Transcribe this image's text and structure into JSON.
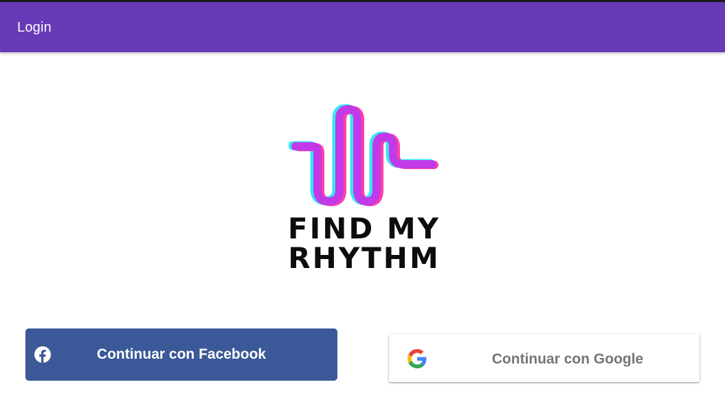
{
  "app_bar": {
    "title": "Login",
    "color": "#673ab7"
  },
  "logo": {
    "line1": "FIND MY",
    "line2": "RHYTHM",
    "wave_color": "#c23ae8",
    "shadow_cyan": "#36e6f2",
    "shadow_pink": "#ff3fa8"
  },
  "buttons": {
    "facebook": {
      "label": "Continuar con Facebook",
      "icon": "facebook-icon",
      "color": "#3b5998"
    },
    "google": {
      "label": "Continuar con Google",
      "icon": "google-icon",
      "color": "#ffffff"
    }
  }
}
